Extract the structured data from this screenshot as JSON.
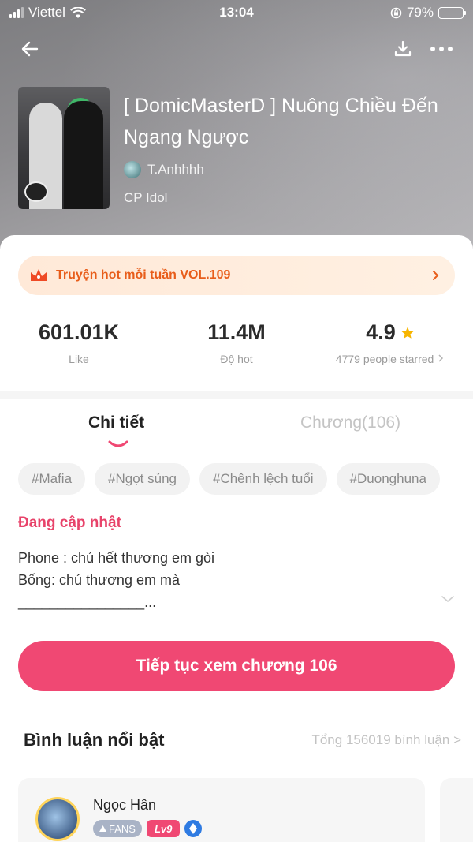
{
  "status_bar": {
    "carrier": "Viettel",
    "time": "13:04",
    "battery_text": "79%",
    "battery_level": 0.79,
    "battery_color": "#f0862a"
  },
  "nav": {
    "back_icon": "arrow-left-icon",
    "download_icon": "download-icon",
    "more_icon": "more-dots-icon"
  },
  "book": {
    "title": "[ DomicMasterD ] Nuông Chiều Đến Ngang Ngược",
    "author": "T.Anhhhh",
    "category": "CP Idol"
  },
  "hot_banner": {
    "label": "Truyện hot mỗi tuần VOL.109",
    "icon": "crown-icon"
  },
  "stats": {
    "likes_value": "601.01K",
    "likes_label": "Like",
    "hot_value": "11.4M",
    "hot_label": "Độ hot",
    "rating_value": "4.9",
    "rating_label": "4779 people starred"
  },
  "tabs": {
    "details": "Chi tiết",
    "chapters": "Chương(106)"
  },
  "tags": [
    "#Mafia",
    "#Ngọt sủng",
    "#Chênh lệch tuổi",
    "#Duonghuna"
  ],
  "description": {
    "status": "Đang cập nhật",
    "line1": "Phone : chú hết thương em gòi",
    "line2": "Bống: chú thương em mà",
    "line3": "________________..."
  },
  "cta": {
    "label": "Tiếp tục xem chương 106"
  },
  "comments": {
    "title": "Bình luận nổi bật",
    "total": "Tổng 156019 bình luận >",
    "first": {
      "name": "Ngọc Hân",
      "fans_badge": "FANS",
      "level_badge": "Lv9"
    }
  },
  "colors": {
    "accent": "#f04873",
    "hot_orange": "#e85d1a",
    "star": "#f7b500"
  }
}
